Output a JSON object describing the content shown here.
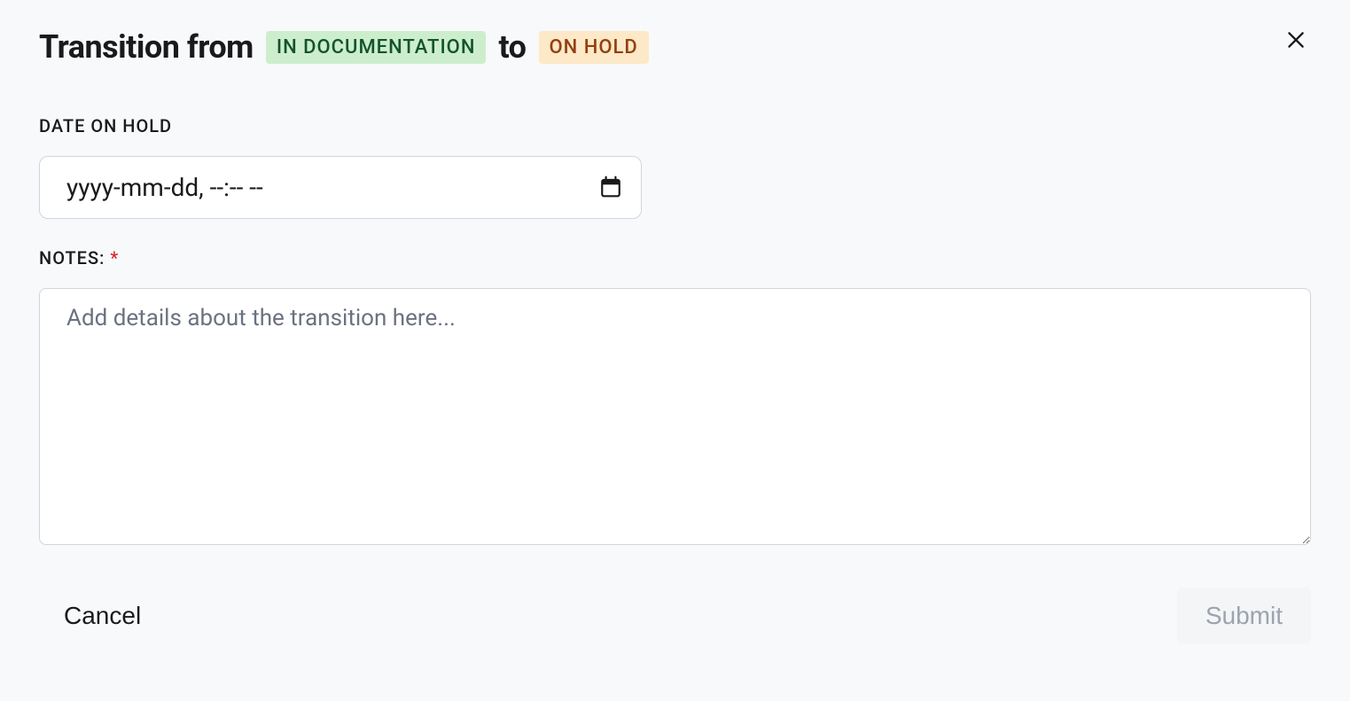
{
  "header": {
    "title_prefix": "Transition from",
    "from_status": "IN DOCUMENTATION",
    "title_mid": "to",
    "to_status": "ON HOLD"
  },
  "fields": {
    "date": {
      "label": "DATE ON HOLD",
      "placeholder": "yyyy-mm-dd, --:-- --",
      "value": ""
    },
    "notes": {
      "label": "NOTES:",
      "required_mark": "*",
      "placeholder": "Add details about the transition here...",
      "value": ""
    }
  },
  "footer": {
    "cancel_label": "Cancel",
    "submit_label": "Submit"
  }
}
